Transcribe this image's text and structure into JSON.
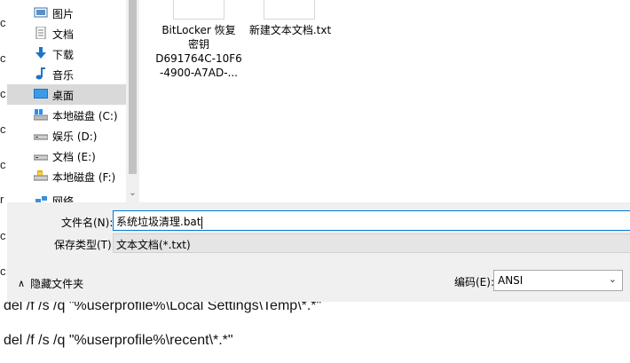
{
  "background": {
    "left_glyphs": [
      "c",
      "c",
      "c",
      "c",
      "c",
      "r",
      "c",
      "c"
    ],
    "lines": [
      "del /f /s /q \"%userprofile%\\Local Settings\\Temp\\*.*\"",
      "del /f /s /q \"%userprofile%\\recent\\*.*\""
    ]
  },
  "nav": {
    "items": [
      {
        "label": "图片",
        "icon": "pictures-icon"
      },
      {
        "label": "文档",
        "icon": "documents-icon"
      },
      {
        "label": "下载",
        "icon": "download-icon"
      },
      {
        "label": "音乐",
        "icon": "music-icon"
      },
      {
        "label": "桌面",
        "icon": "desktop-icon"
      },
      {
        "label": "本地磁盘 (C:)",
        "icon": "system-drive-icon"
      },
      {
        "label": "娱乐 (D:)",
        "icon": "drive-icon"
      },
      {
        "label": "文档 (E:)",
        "icon": "drive-icon"
      },
      {
        "label": "本地磁盘 (F:)",
        "icon": "drive-icon"
      },
      {
        "label": "网络",
        "icon": "network-icon"
      }
    ]
  },
  "files": [
    {
      "name": "BitLocker 恢复\n密钥\nD691764C-10F6\n-4900-A7AD-..."
    },
    {
      "name": "新建文本文档.txt"
    }
  ],
  "form": {
    "filename_label": "文件名(N):",
    "filename_value": "系统垃圾清理.bat",
    "type_label": "保存类型(T):",
    "type_value": "文本文档(*.txt)",
    "hide_folders_label": "隐藏文件夹",
    "encoding_label": "编码(E):",
    "encoding_value": "ANSI"
  },
  "colors": {
    "selection": "#d9d9d9",
    "input_border": "#0078d7",
    "dialog_bg": "#f0f0f0"
  }
}
